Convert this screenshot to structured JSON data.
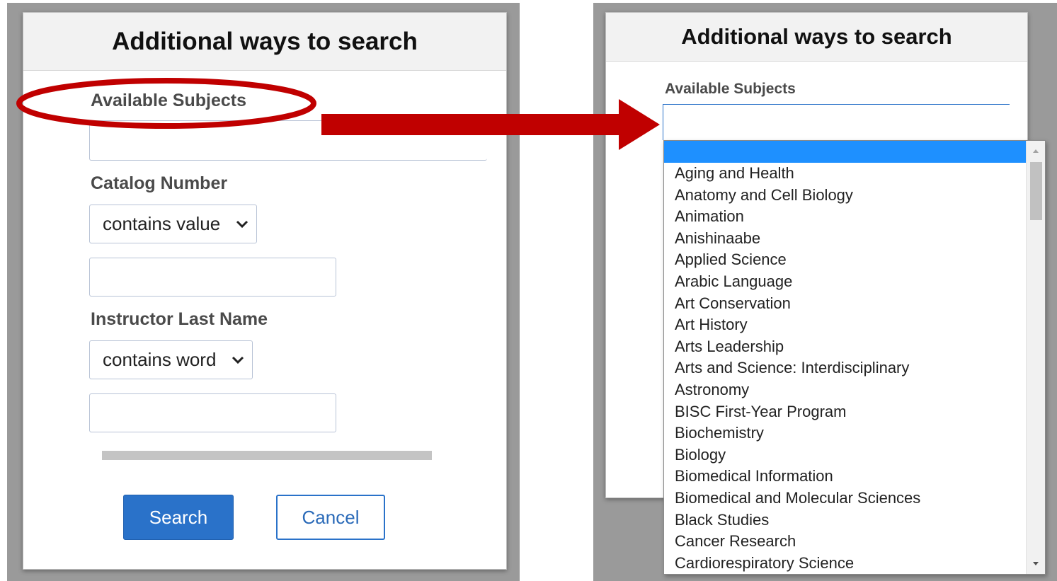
{
  "left_dialog": {
    "title": "Additional ways to search",
    "subjects_label": "Available Subjects",
    "catalog_label": "Catalog Number",
    "catalog_operator": "contains value",
    "instructor_label": "Instructor Last Name",
    "instructor_operator": "contains word",
    "search_label": "Search",
    "cancel_label": "Cancel"
  },
  "right_dialog": {
    "title": "Additional ways to search",
    "subjects_label": "Available Subjects",
    "dropdown_options": [
      "",
      "Aging and Health",
      "Anatomy and Cell Biology",
      "Animation",
      "Anishinaabe",
      "Applied Science",
      "Arabic Language",
      "Art Conservation",
      "Art History",
      "Arts Leadership",
      "Arts and Science: Interdisciplinary",
      "Astronomy",
      "BISC First-Year Program",
      "Biochemistry",
      "Biology",
      "Biomedical Information",
      "Biomedical and Molecular Sciences",
      "Black Studies",
      "Cancer Research",
      "Cardiorespiratory Science"
    ]
  },
  "colors": {
    "primary_button": "#2a72c9",
    "highlight_red": "#c00000",
    "selected_option": "#1e90ff"
  }
}
